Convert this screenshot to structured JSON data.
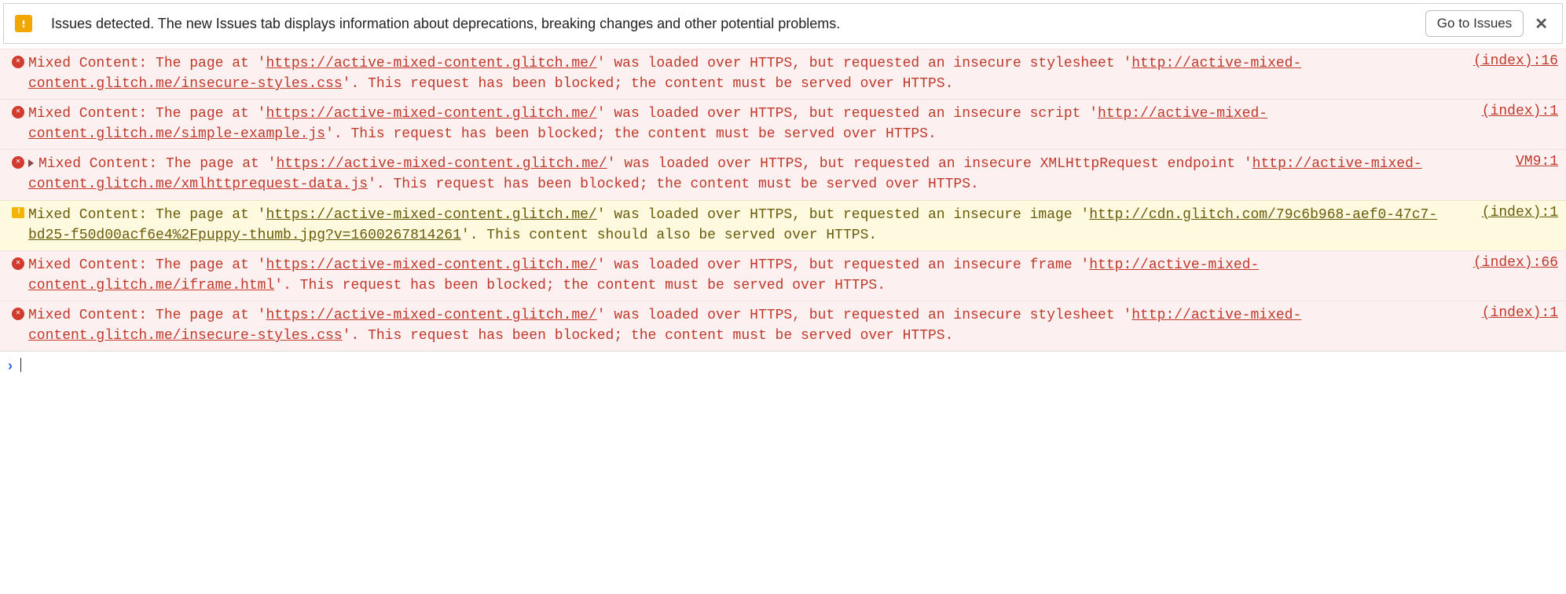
{
  "issues_bar": {
    "text": "Issues detected. The new Issues tab displays information about deprecations, breaking changes and other potential problems.",
    "button": "Go to Issues"
  },
  "messages": [
    {
      "level": "error",
      "expandable": false,
      "parts": [
        {
          "t": "plain",
          "v": "Mixed Content: The page at '"
        },
        {
          "t": "link",
          "v": "https://active-mixed-content.glitch.me/"
        },
        {
          "t": "plain",
          "v": "' was loaded over HTTPS, but requested an insecure stylesheet '"
        },
        {
          "t": "link",
          "v": "http://active-mixed-content.glitch.me/insecure-styles.css"
        },
        {
          "t": "plain",
          "v": "'. This request has been blocked; the content must be served over HTTPS."
        }
      ],
      "source": "(index):16"
    },
    {
      "level": "error",
      "expandable": false,
      "parts": [
        {
          "t": "plain",
          "v": "Mixed Content: The page at '"
        },
        {
          "t": "link",
          "v": "https://active-mixed-content.glitch.me/"
        },
        {
          "t": "plain",
          "v": "' was loaded over HTTPS, but requested an insecure script '"
        },
        {
          "t": "link",
          "v": "http://active-mixed-content.glitch.me/simple-example.js"
        },
        {
          "t": "plain",
          "v": "'. This request has been blocked; the content must be served over HTTPS."
        }
      ],
      "source": "(index):1"
    },
    {
      "level": "error",
      "expandable": true,
      "parts": [
        {
          "t": "plain",
          "v": "Mixed Content: The page at '"
        },
        {
          "t": "link",
          "v": "https://active-mixed-content.glitch.me/"
        },
        {
          "t": "plain",
          "v": "' was loaded over HTTPS, but requested an insecure XMLHttpRequest endpoint '"
        },
        {
          "t": "link",
          "v": "http://active-mixed-content.glitch.me/xmlhttprequest-data.js"
        },
        {
          "t": "plain",
          "v": "'. This request has been blocked; the content must be served over HTTPS."
        }
      ],
      "source": "VM9:1"
    },
    {
      "level": "warn",
      "expandable": false,
      "parts": [
        {
          "t": "plain",
          "v": "Mixed Content: The page at '"
        },
        {
          "t": "link",
          "v": "https://active-mixed-content.glitch.me/"
        },
        {
          "t": "plain",
          "v": "' was loaded over HTTPS, but requested an insecure image '"
        },
        {
          "t": "link",
          "v": "http://cdn.glitch.com/79c6b968-aef0-47c7-bd25-f50d00acf6e4%2Fpuppy-thumb.jpg?v=1600267814261"
        },
        {
          "t": "plain",
          "v": "'. This content should also be served over HTTPS."
        }
      ],
      "source": "(index):1"
    },
    {
      "level": "error",
      "expandable": false,
      "parts": [
        {
          "t": "plain",
          "v": "Mixed Content: The page at '"
        },
        {
          "t": "link",
          "v": "https://active-mixed-content.glitch.me/"
        },
        {
          "t": "plain",
          "v": "' was loaded over HTTPS, but requested an insecure frame '"
        },
        {
          "t": "link",
          "v": "http://active-mixed-content.glitch.me/iframe.html"
        },
        {
          "t": "plain",
          "v": "'. This request has been blocked; the content must be served over HTTPS."
        }
      ],
      "source": "(index):66"
    },
    {
      "level": "error",
      "expandable": false,
      "parts": [
        {
          "t": "plain",
          "v": "Mixed Content: The page at '"
        },
        {
          "t": "link",
          "v": "https://active-mixed-content.glitch.me/"
        },
        {
          "t": "plain",
          "v": "' was loaded over HTTPS, but requested an insecure stylesheet '"
        },
        {
          "t": "link",
          "v": "http://active-mixed-content.glitch.me/insecure-styles.css"
        },
        {
          "t": "plain",
          "v": "'. This request has been blocked; the content must be served over HTTPS."
        }
      ],
      "source": "(index):1"
    }
  ]
}
